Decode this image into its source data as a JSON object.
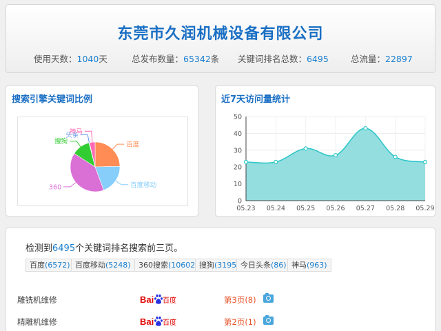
{
  "header": {
    "title": "东莞市久润机械设备有限公司",
    "stats": [
      {
        "label": "使用天数：",
        "value": "1040",
        "unit": "天"
      },
      {
        "label": "总发布数量：",
        "value": "65342",
        "unit": "条"
      },
      {
        "label": "关键词排名总数：",
        "value": "6495",
        "unit": ""
      },
      {
        "label": "总流量：",
        "value": "22897",
        "unit": ""
      }
    ]
  },
  "pie_panel": {
    "title": "搜索引擎关键词比例"
  },
  "line_panel": {
    "title": "近7天访问量统计"
  },
  "chart_data": [
    {
      "type": "pie",
      "slices": [
        {
          "name": "百度",
          "value": 6572,
          "color": "#ff8c55"
        },
        {
          "name": "百度移动",
          "value": 5248,
          "color": "#87cefa"
        },
        {
          "name": "360",
          "value": 10602,
          "color": "#da70d6"
        },
        {
          "name": "搜狗",
          "value": 3195,
          "color": "#32cd32"
        },
        {
          "name": "头条",
          "value": 86,
          "color": "#6495ed"
        },
        {
          "name": "神马",
          "value": 963,
          "color": "#ff69b4"
        }
      ]
    },
    {
      "type": "area",
      "x": [
        "05.23",
        "05.24",
        "05.25",
        "05.26",
        "05.27",
        "05.28",
        "05.29"
      ],
      "values": [
        23,
        23,
        31,
        27,
        43,
        26,
        23
      ],
      "ylim": [
        0,
        50
      ],
      "yticks": [
        0,
        10,
        20,
        30,
        40,
        50
      ],
      "grid": true,
      "line_color": "#2ec7c9",
      "fill_color": "#8fdcdd"
    }
  ],
  "keywords": {
    "detect_prefix": "检测到",
    "detect_value": "6495",
    "detect_suffix": "个关键词排名搜索前三页。",
    "tags": [
      {
        "name": "百度",
        "count": "(6572)"
      },
      {
        "name": "百度移动",
        "count": "(5248)"
      },
      {
        "name": "360搜索",
        "count": "(10602)"
      },
      {
        "name": "搜狗",
        "count": "(3195)"
      },
      {
        "name": "今日头条",
        "count": "(86)"
      },
      {
        "name": "神马",
        "count": "(963)"
      }
    ],
    "rows": [
      {
        "keyword": "雕铣机维修",
        "engine_logo": "Bai百度",
        "rank": "第3页(8)"
      },
      {
        "keyword": "精雕机维修",
        "engine_logo": "Bai百度",
        "rank": "第2页(1)"
      }
    ]
  }
}
